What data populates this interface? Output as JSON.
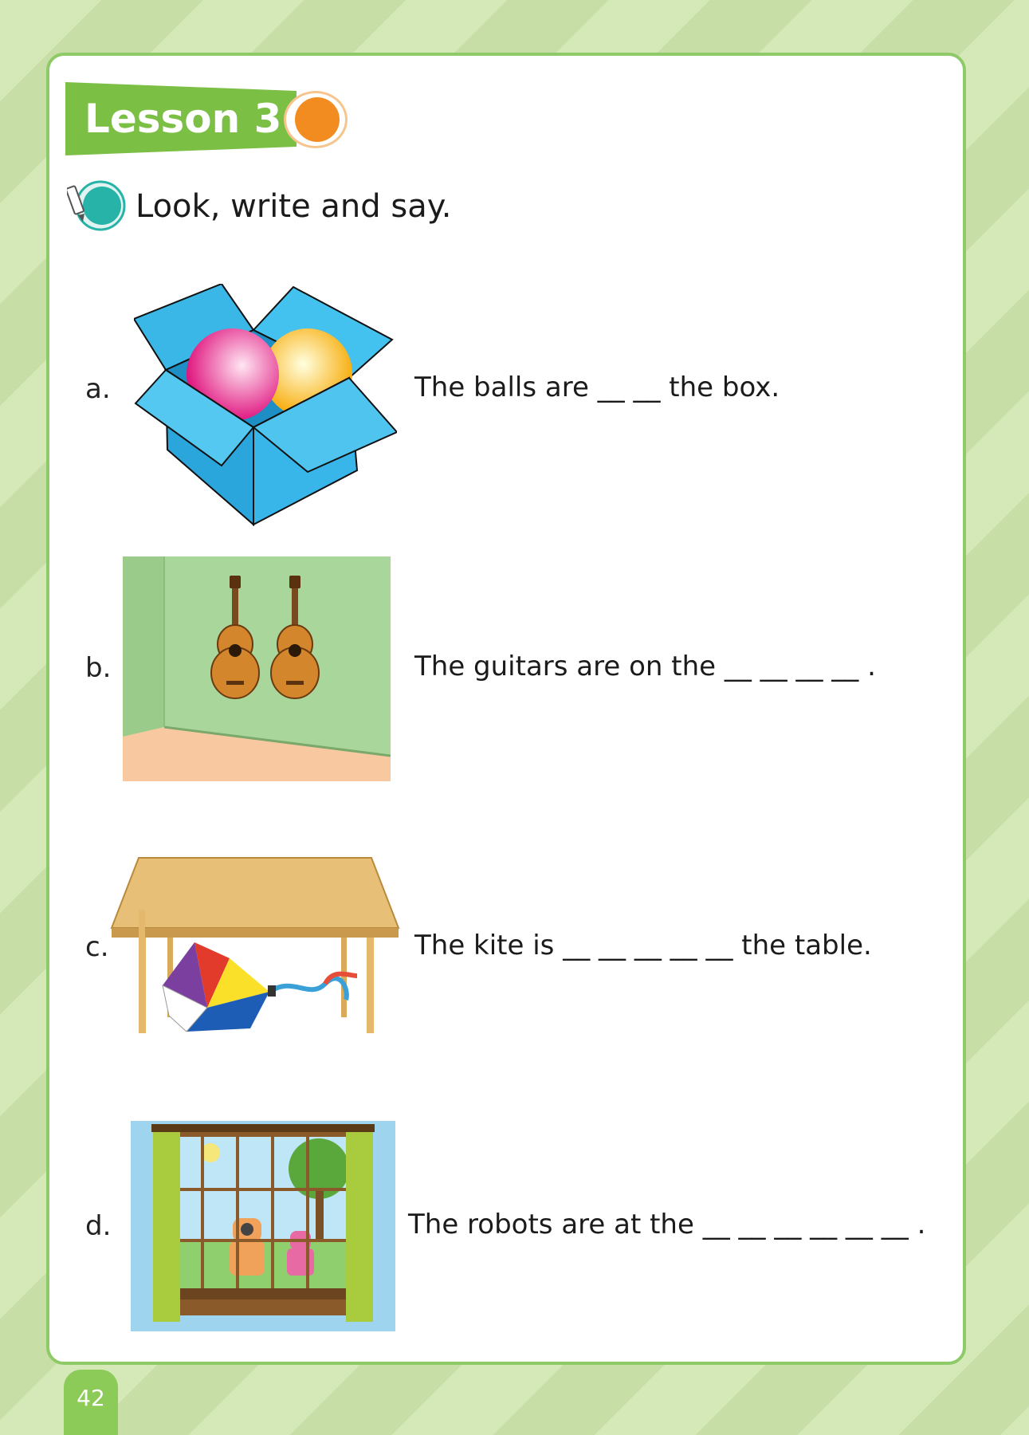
{
  "lesson": {
    "title": "Lesson 3"
  },
  "instruction": {
    "text": "Look, write and say."
  },
  "exercises": [
    {
      "letter": "a.",
      "before": "The balls are",
      "blank": "__ __",
      "after": "the box.",
      "picture": "box-with-balls"
    },
    {
      "letter": "b.",
      "before": "The guitars are on the",
      "blank": "__ __ __ __",
      "after": ".",
      "picture": "guitars-on-wall"
    },
    {
      "letter": "c.",
      "before": "The kite is",
      "blank": "__ __ __ __ __",
      "after": "the table.",
      "picture": "kite-under-table"
    },
    {
      "letter": "d.",
      "before": "The robots are at the",
      "blank": "__ __ __ __ __ __",
      "after": ".",
      "picture": "robots-at-window"
    }
  ],
  "footer": {
    "page_number": "42"
  },
  "colors": {
    "accent_green": "#7bbf44",
    "accent_orange": "#f28c20",
    "icon_teal": "#27b3a8"
  }
}
